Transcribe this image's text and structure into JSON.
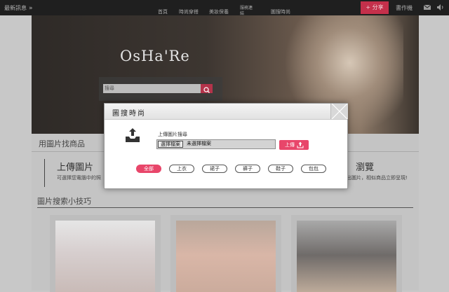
{
  "topbar": {
    "latest_label": "最新訊息",
    "latest_chevron": "»",
    "nav": [
      "首頁",
      "時尚穿搭",
      "美妝保養",
      "服務連結",
      "圖搜時尚"
    ],
    "share_label": "+ 分享",
    "book_label": "書作機",
    "icons": [
      "mail-icon",
      "volume-icon"
    ]
  },
  "hero": {
    "logo": "OsHa'Re",
    "search_placeholder": "搜尋"
  },
  "page": {
    "section1_title": "用圖片找商品",
    "upload_title": "上傳圖片",
    "upload_desc": "可選擇您電腦中的照",
    "right_title": "瀏覽",
    "right_desc": "找出圖片，相似商品立即呈現!",
    "section2_title": "圖片搜索小技巧"
  },
  "dialog": {
    "title": "圖搜時尚",
    "upload_label": "上傳圖片搜尋",
    "file_button": "選擇檔案",
    "file_status": "未選擇檔案",
    "upload_button": "上傳",
    "categories": [
      "全部",
      "上衣",
      "裙子",
      "褲子",
      "鞋子",
      "包包"
    ],
    "active_category": "全部"
  },
  "colors": {
    "accent": "#e8466a",
    "share": "#c4304b",
    "topbar": "#1f1f1f"
  }
}
